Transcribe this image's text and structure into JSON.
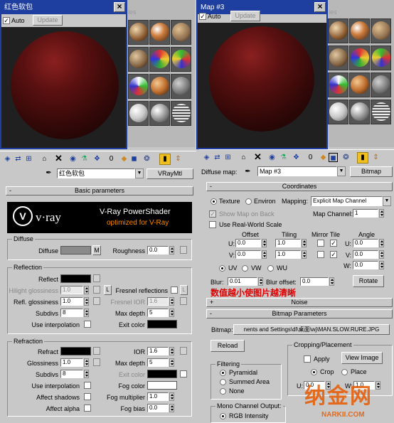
{
  "left_window": {
    "title": "红色软包",
    "auto_label": "Auto",
    "update_label": "Update"
  },
  "right_window": {
    "title": "Map #3",
    "auto_label": "Auto",
    "update_label": "Update"
  },
  "bg_slot_text_left": "les",
  "bg_slot_text_right": "les",
  "left_editor": {
    "material_name": "红色软包",
    "material_type": "VRayMtl",
    "basic_params_title": "Basic parameters",
    "vray_logo": "v·ray",
    "vray_line1": "V-Ray PowerShader",
    "vray_line2": "optimized for V-Ray",
    "diffuse_group": "Diffuse",
    "diffuse_label": "Diffuse",
    "diffuse_m": "M",
    "roughness_label": "Roughness",
    "roughness_value": "0.0",
    "reflection_group": "Reflection",
    "reflect_label": "Reflect",
    "hilight_label": "Hilight glossiness",
    "hilight_value": "1.0",
    "l_label": "L",
    "fresnel_label": "Fresnel reflections",
    "refl_gloss_label": "Refl. glossiness",
    "refl_gloss_value": "1.0",
    "fresnel_ior_label": "Fresnel IOR",
    "fresnel_ior_value": "1.6",
    "subdivs_label": "Subdivs",
    "subdivs_value": "8",
    "max_depth_label": "Max depth",
    "max_depth_value": "5",
    "use_interp_label": "Use interpolation",
    "exit_color_label": "Exit color",
    "refraction_group": "Refraction",
    "refract_label": "Refract",
    "ior_label": "IOR",
    "ior_value": "1.6",
    "gloss_label": "Glossiness",
    "gloss_value": "1.0",
    "r_max_depth_label": "Max depth",
    "r_max_depth_value": "5",
    "r_subdivs_label": "Subdivs",
    "r_subdivs_value": "8",
    "r_exit_color_label": "Exit color",
    "r_use_interp_label": "Use interpolation",
    "fog_color_label": "Fog color",
    "affect_shadows_label": "Affect shadows",
    "fog_mult_label": "Fog multiplier",
    "fog_mult_value": "1.0",
    "affect_alpha_label": "Affect alpha",
    "fog_bias_label": "Fog bias",
    "fog_bias_value": "0.0"
  },
  "right_editor": {
    "diffuse_map_label": "Diffuse map:",
    "map_name": "Map #3",
    "map_type": "Bitmap",
    "coords_title": "Coordinates",
    "texture_label": "Texture",
    "environ_label": "Environ",
    "mapping_label": "Mapping:",
    "mapping_value": "Explicit Map Channel",
    "show_map_label": "Show Map on Back",
    "map_channel_label": "Map Channel:",
    "map_channel_value": "1",
    "real_world_label": "Use Real-World Scale",
    "offset_label": "Offset",
    "tiling_label": "Tiling",
    "mirror_tile_label": "Mirror Tile",
    "angle_label": "Angle",
    "u_label": "U:",
    "v_label": "V:",
    "w_label": "W:",
    "u_offset": "0.0",
    "v_offset": "0.0",
    "u_tiling": "1.0",
    "v_tiling": "1.0",
    "u_angle": "0.0",
    "v_angle": "0.0",
    "w_angle": "0.0",
    "uv_label": "UV",
    "vw_label": "VW",
    "wu_label": "WU",
    "blur_label": "Blur:",
    "blur_value": "0.01",
    "blur_offset_label": "Blur offset:",
    "blur_offset_value": "0.0",
    "rotate_label": "Rotate",
    "annotation": "数值越小使图片越清晰",
    "noise_title": "Noise",
    "bitmap_params_title": "Bitmap Parameters",
    "bitmap_label": "Bitmap:",
    "bitmap_path": "nents and Settings\\dl\\桌面\\wj\\MAN.SLOW.RURE.JPG",
    "reload_label": "Reload",
    "cropping_group": "Cropping/Placement",
    "apply_label": "Apply",
    "view_image_label": "View Image",
    "crop_label": "Crop",
    "place_label": "Place",
    "crop_u_label": "U:",
    "crop_u_value": "0.0",
    "crop_w_label": "W:",
    "crop_w_value": "1.0",
    "filtering_group": "Filtering",
    "pyramidal_label": "Pyramidal",
    "summed_area_label": "Summed Area",
    "none_label": "None",
    "mono_group": "Mono Channel Output:",
    "rgb_intensity_label": "RGB Intensity"
  },
  "watermark": {
    "text": "纳金网",
    "url": "NARKII.COM"
  },
  "colors": {
    "title_bar": "#1e3fa0",
    "annotation": "#e00000",
    "vray_orange": "#ff8a00"
  }
}
